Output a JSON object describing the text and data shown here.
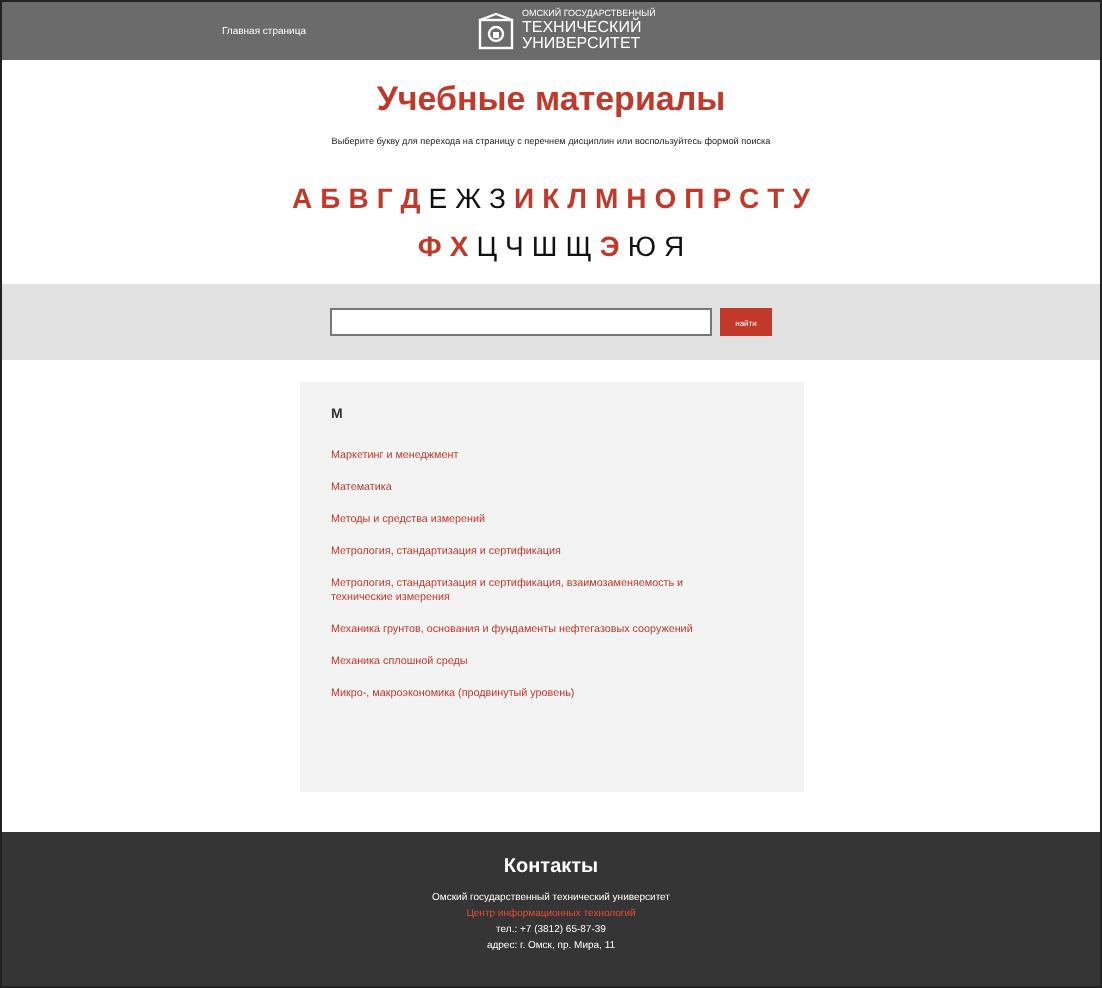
{
  "header": {
    "home_link": "Главная страница",
    "logo": {
      "line1": "ОМСКИЙ ГОСУДАРСТВЕННЫЙ",
      "line2": "ТЕХНИЧЕСКИЙ",
      "line3": "УНИВЕРСИТЕТ"
    }
  },
  "title": "Учебные материалы",
  "subtitle": "Выберите букву для перехода на страницу с перечнем дисциплин или воспользуйтесь формой поиска",
  "alphabet": [
    [
      {
        "letter": "А",
        "available": true
      },
      {
        "letter": "Б",
        "available": true
      },
      {
        "letter": "В",
        "available": true
      },
      {
        "letter": "Г",
        "available": true
      },
      {
        "letter": "Д",
        "available": true
      },
      {
        "letter": "Е",
        "available": false
      },
      {
        "letter": "Ж",
        "available": false
      },
      {
        "letter": "З",
        "available": false
      },
      {
        "letter": "И",
        "available": true
      },
      {
        "letter": "К",
        "available": true
      },
      {
        "letter": "Л",
        "available": true
      },
      {
        "letter": "М",
        "available": true
      },
      {
        "letter": "Н",
        "available": true
      },
      {
        "letter": "О",
        "available": true
      },
      {
        "letter": "П",
        "available": true
      },
      {
        "letter": "Р",
        "available": true
      },
      {
        "letter": "С",
        "available": true
      },
      {
        "letter": "Т",
        "available": true
      },
      {
        "letter": "У",
        "available": true
      }
    ],
    [
      {
        "letter": "Ф",
        "available": true
      },
      {
        "letter": "Х",
        "available": true
      },
      {
        "letter": "Ц",
        "available": false
      },
      {
        "letter": "Ч",
        "available": false
      },
      {
        "letter": "Ш",
        "available": false
      },
      {
        "letter": "Щ",
        "available": false
      },
      {
        "letter": "Э",
        "available": true
      },
      {
        "letter": "Ю",
        "available": false
      },
      {
        "letter": "Я",
        "available": false
      }
    ]
  ],
  "search": {
    "button": "найти"
  },
  "subjects": {
    "heading": "М",
    "items": [
      "Маркетинг и менеджмент",
      "Математика",
      "Методы и средства измерений",
      "Метрология, стандартизация и сертификация",
      "Метрология, стандартизация и сертификация, взаимозаменяемость и технические измерения",
      "Механика грунтов, основания и фундаменты нефтегазовых сооружений",
      "Механика сплошной среды",
      "Микро-, макроэкономика (продвинутый уровень)"
    ]
  },
  "footer": {
    "heading": "Контакты",
    "org": "Омский государственный технический университет",
    "link": "Центр информационных технологий",
    "phone": "тел.: +7 (3812) 65-87-39",
    "address": "адрес: г. Омск, пр. Мира, 11"
  }
}
